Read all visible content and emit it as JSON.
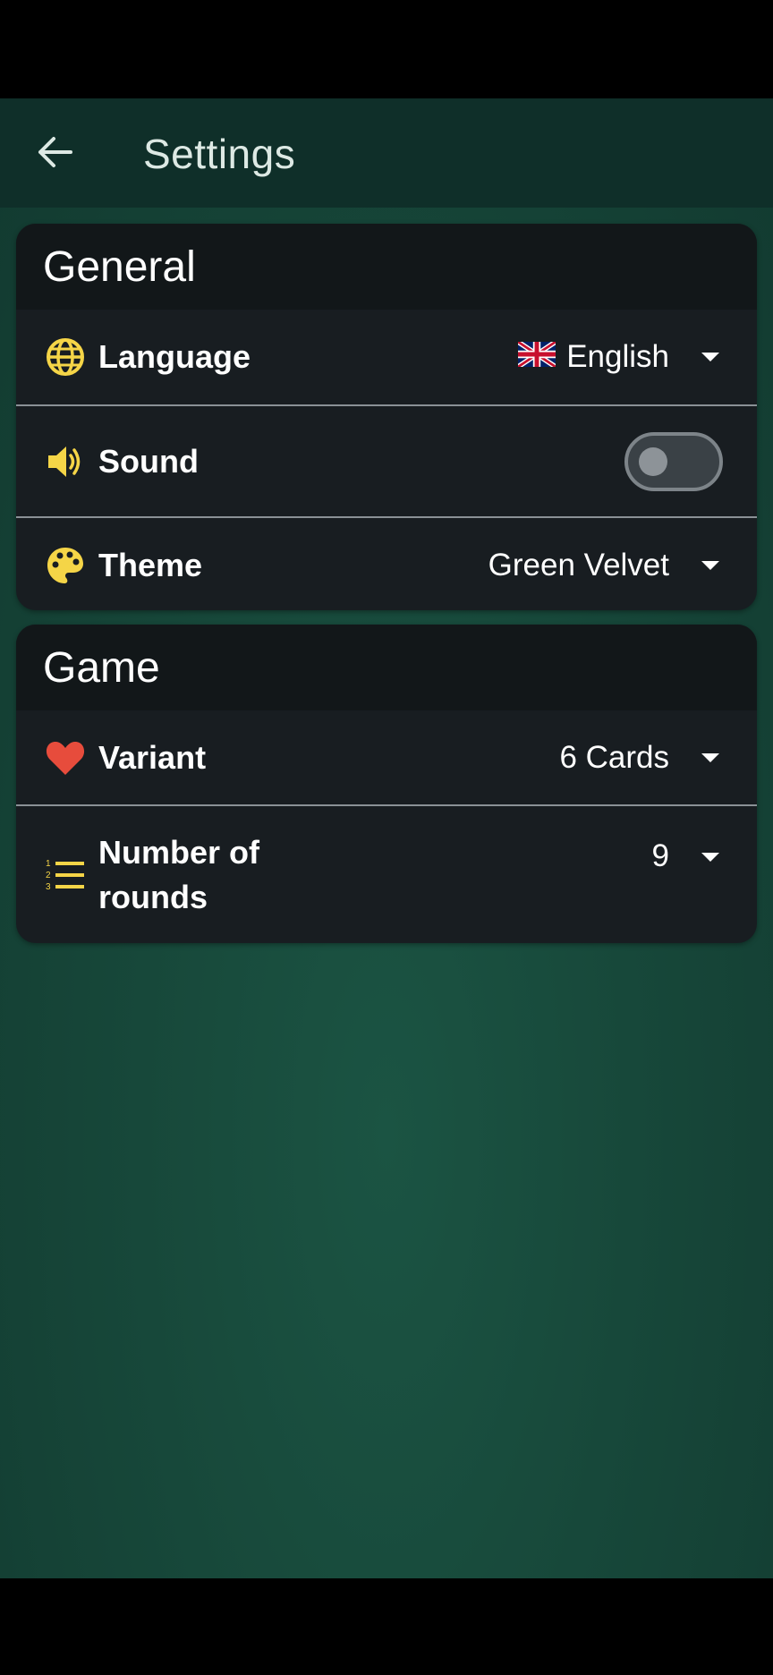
{
  "header": {
    "title": "Settings",
    "back_icon": "arrow-left-icon"
  },
  "sections": {
    "general": {
      "title": "General",
      "language": {
        "label": "Language",
        "value": "English",
        "flag_icon": "uk-flag-icon",
        "icon": "globe-icon"
      },
      "sound": {
        "label": "Sound",
        "enabled": false,
        "icon": "speaker-icon"
      },
      "theme": {
        "label": "Theme",
        "value": "Green Velvet",
        "icon": "palette-icon"
      }
    },
    "game": {
      "title": "Game",
      "variant": {
        "label": "Variant",
        "value": "6 Cards",
        "icon": "heart-icon"
      },
      "rounds": {
        "label": "Number of rounds",
        "value": "9",
        "icon": "numbered-list-icon"
      }
    }
  },
  "colors": {
    "accent_icon": "#f5d547",
    "heart": "#e74c3c",
    "background_green": "#17483a",
    "card": "#181d21"
  }
}
